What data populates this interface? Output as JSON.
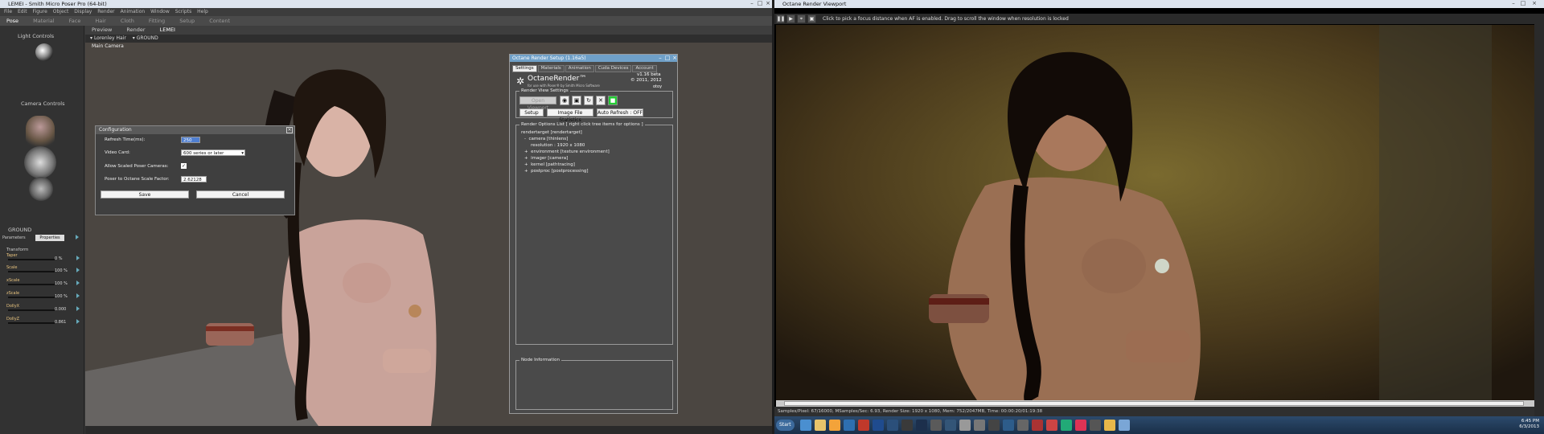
{
  "poser": {
    "title": "LEMEI - Smith Micro Poser Pro (64-bit)",
    "menu": [
      "File",
      "Edit",
      "Figure",
      "Object",
      "Display",
      "Render",
      "Animation",
      "Window",
      "Scripts",
      "Help"
    ],
    "tabs": [
      "Pose",
      "Material",
      "Face",
      "Hair",
      "Cloth",
      "Fitting",
      "Setup",
      "Content"
    ],
    "active_tab": "Pose",
    "light_controls": "Light Controls",
    "camera_controls": "Camera Controls",
    "ground_label": "GROUND",
    "param_tabs": [
      "Parameters",
      "Properties"
    ],
    "transform_label": "Transform",
    "params": [
      {
        "name": "Taper",
        "value": "0 %"
      },
      {
        "name": "Scale",
        "value": "100 %"
      },
      {
        "name": "xScale",
        "value": "100 %"
      },
      {
        "name": "zScale",
        "value": "100 %"
      },
      {
        "name": "DollyX",
        "value": "0.000"
      },
      {
        "name": "DollyZ",
        "value": "0.861"
      }
    ],
    "view_tabs": [
      "Preview",
      "Render",
      "LEMEI"
    ],
    "figure_select": "Lorenley Hair",
    "actor_select": "GROUND",
    "camera_name": "Main Camera"
  },
  "config": {
    "title": "Configuration",
    "refresh_label": "Refresh Time(ms):",
    "refresh_value": "250",
    "video_label": "Video Card:",
    "video_value": "600 series or later",
    "scaled_label": "Allow Scaled Poser Cameras:",
    "scaled_checked": true,
    "scale_label": "Poser to Octane Scale Factor:",
    "scale_value": "2.62128",
    "save": "Save",
    "cancel": "Cancel"
  },
  "octane_setup": {
    "title": "Octane Render Setup (1.16a5)",
    "tabs": [
      "Settings",
      "Materials",
      "Animation",
      "Cuda Devices",
      "Account"
    ],
    "active_tab": "Settings",
    "version": "v1.16 beta",
    "copyright": "© 2011, 2012",
    "product": "OctaneRender™",
    "product_sub": "for use with Poser® by Smith Micro Software",
    "otoy": "otoy",
    "rv_settings": "Render View Settings",
    "open_viewport": "Open Viewport",
    "setup": "Setup",
    "image_stats": "Image File Statistics",
    "auto_refresh": "Auto Refresh : OFF",
    "options_list": "Render Options List",
    "options_hint": "[ right click tree items for options ]",
    "tree": [
      {
        "text": "rendertarget   [rendertarget]",
        "indent": 0
      },
      {
        "text": "camera   [thinlens]",
        "indent": 1,
        "toggle": "-"
      },
      {
        "text": "resolution  :  1920 x 1080",
        "indent": 2
      },
      {
        "text": "environment   [texture environment]",
        "indent": 1,
        "toggle": "+"
      },
      {
        "text": "imager   [camera]",
        "indent": 1,
        "toggle": "+"
      },
      {
        "text": "kernel   [pathtracing]",
        "indent": 1,
        "toggle": "+"
      },
      {
        "text": "postproc   [postprocessing]",
        "indent": 1,
        "toggle": "+"
      }
    ],
    "node_info": "Node Information"
  },
  "octane_view": {
    "title": "Octane Render Viewport",
    "hint": "Click to pick a focus distance when AF is enabled.  Drag to scroll the window when resolution is locked",
    "status": "Samples/Pixel: 67/16000, MSamples/Sec: 6.93, Render Size: 1920 x 1080, Mem: 752/2047MB, Time: 00:00:20/01:19:38",
    "start": "Start",
    "time": "6:45 PM",
    "date": "6/3/2013"
  },
  "colors": {
    "accent": "#6fa0c8",
    "slider_label": "#e9c47e"
  }
}
